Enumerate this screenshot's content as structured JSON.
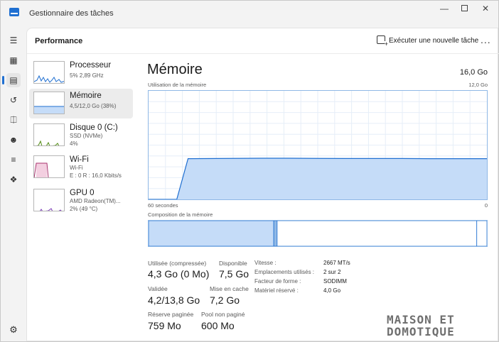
{
  "window": {
    "title": "Gestionnaire des tâches"
  },
  "nav": {
    "icons": [
      "menu-icon",
      "processes-icon",
      "performance-icon",
      "history-icon",
      "startup-icon",
      "users-icon",
      "details-icon",
      "services-icon"
    ],
    "active": "performance-icon",
    "settings_icon": "gear-icon"
  },
  "header": {
    "title": "Performance",
    "run_task_label": "Exécuter une nouvelle tâche",
    "more_label": "..."
  },
  "devices": [
    {
      "name": "Processeur",
      "lines": [
        "5% 2,89 GHz"
      ],
      "utilization": 0.05,
      "color": "#1f6fd1"
    },
    {
      "name": "Mémoire",
      "lines": [
        "4,5/12,0 Go (38%)"
      ],
      "utilization": 0.38,
      "color": "#1f6fd1"
    },
    {
      "name": "Disque 0 (C:)",
      "lines": [
        "SSD (NVMe)",
        "4%"
      ],
      "utilization": 0.04,
      "color": "#4f8a10"
    },
    {
      "name": "Wi-Fi",
      "lines": [
        "Wi-Fi",
        "E : 0 R : 16,0 Kbits/s"
      ],
      "color": "#a8326e"
    },
    {
      "name": "GPU 0",
      "lines": [
        "AMD Radeon(TM)...",
        "2% (49 °C)"
      ],
      "utilization": 0.02,
      "color": "#7a3bb5"
    }
  ],
  "memory": {
    "title": "Mémoire",
    "total": "16,0 Go",
    "usage_label": "Utilisation de la mémoire",
    "usage_max": "12,0 Go",
    "time_left": "60 secondes",
    "time_right": "0",
    "composition_label": "Composition de la mémoire",
    "composition_segments": [
      {
        "type": "in-use",
        "fraction": 0.37,
        "color": "#c5dcf8"
      },
      {
        "type": "modified",
        "fraction": 0.01,
        "color": "#8fb8e6"
      },
      {
        "type": "standby",
        "fraction": 0.59,
        "color": "#ffffff"
      },
      {
        "type": "free",
        "fraction": 0.03,
        "color": "#ffffff"
      }
    ],
    "stats": {
      "used_label": "Utilisée (compressée)",
      "used_value": "4,3 Go (0 Mo)",
      "available_label": "Disponible",
      "available_value": "7,5 Go",
      "committed_label": "Validée",
      "committed_value": "4,2/13,8 Go",
      "cached_label": "Mise en cache",
      "cached_value": "7,2 Go",
      "paged_label": "Réserve paginée",
      "paged_value": "759 Mo",
      "nonpaged_label": "Pool non paginé",
      "nonpaged_value": "600 Mo"
    },
    "specs": {
      "speed_label": "Vitesse :",
      "speed_value": "2667 MT/s",
      "slots_label": "Emplacements utilisés :",
      "slots_value": "2 sur 2",
      "form_label": "Facteur de forme :",
      "form_value": "SODIMM",
      "reserved_label": "Matériel réservé :",
      "reserved_value": "4,0 Go"
    }
  },
  "chart_data": {
    "type": "area",
    "title": "Utilisation de la mémoire",
    "xlabel": "",
    "ylabel": "",
    "x_range_labels": [
      "60 secondes",
      "0"
    ],
    "ylim": [
      0,
      12
    ],
    "y_unit": "Go",
    "x": [
      0,
      5,
      7,
      12,
      20,
      25,
      30,
      35,
      40,
      45,
      50,
      55,
      60
    ],
    "series": [
      {
        "values": [
          0,
          0,
          4.5,
          4.52,
          4.55,
          4.55,
          4.53,
          4.52,
          4.52,
          4.52,
          4.5,
          4.5,
          4.5
        ]
      }
    ],
    "grid": true
  },
  "watermark": {
    "line1": "MAISON ET",
    "line2": "DOMOTIQUE"
  }
}
